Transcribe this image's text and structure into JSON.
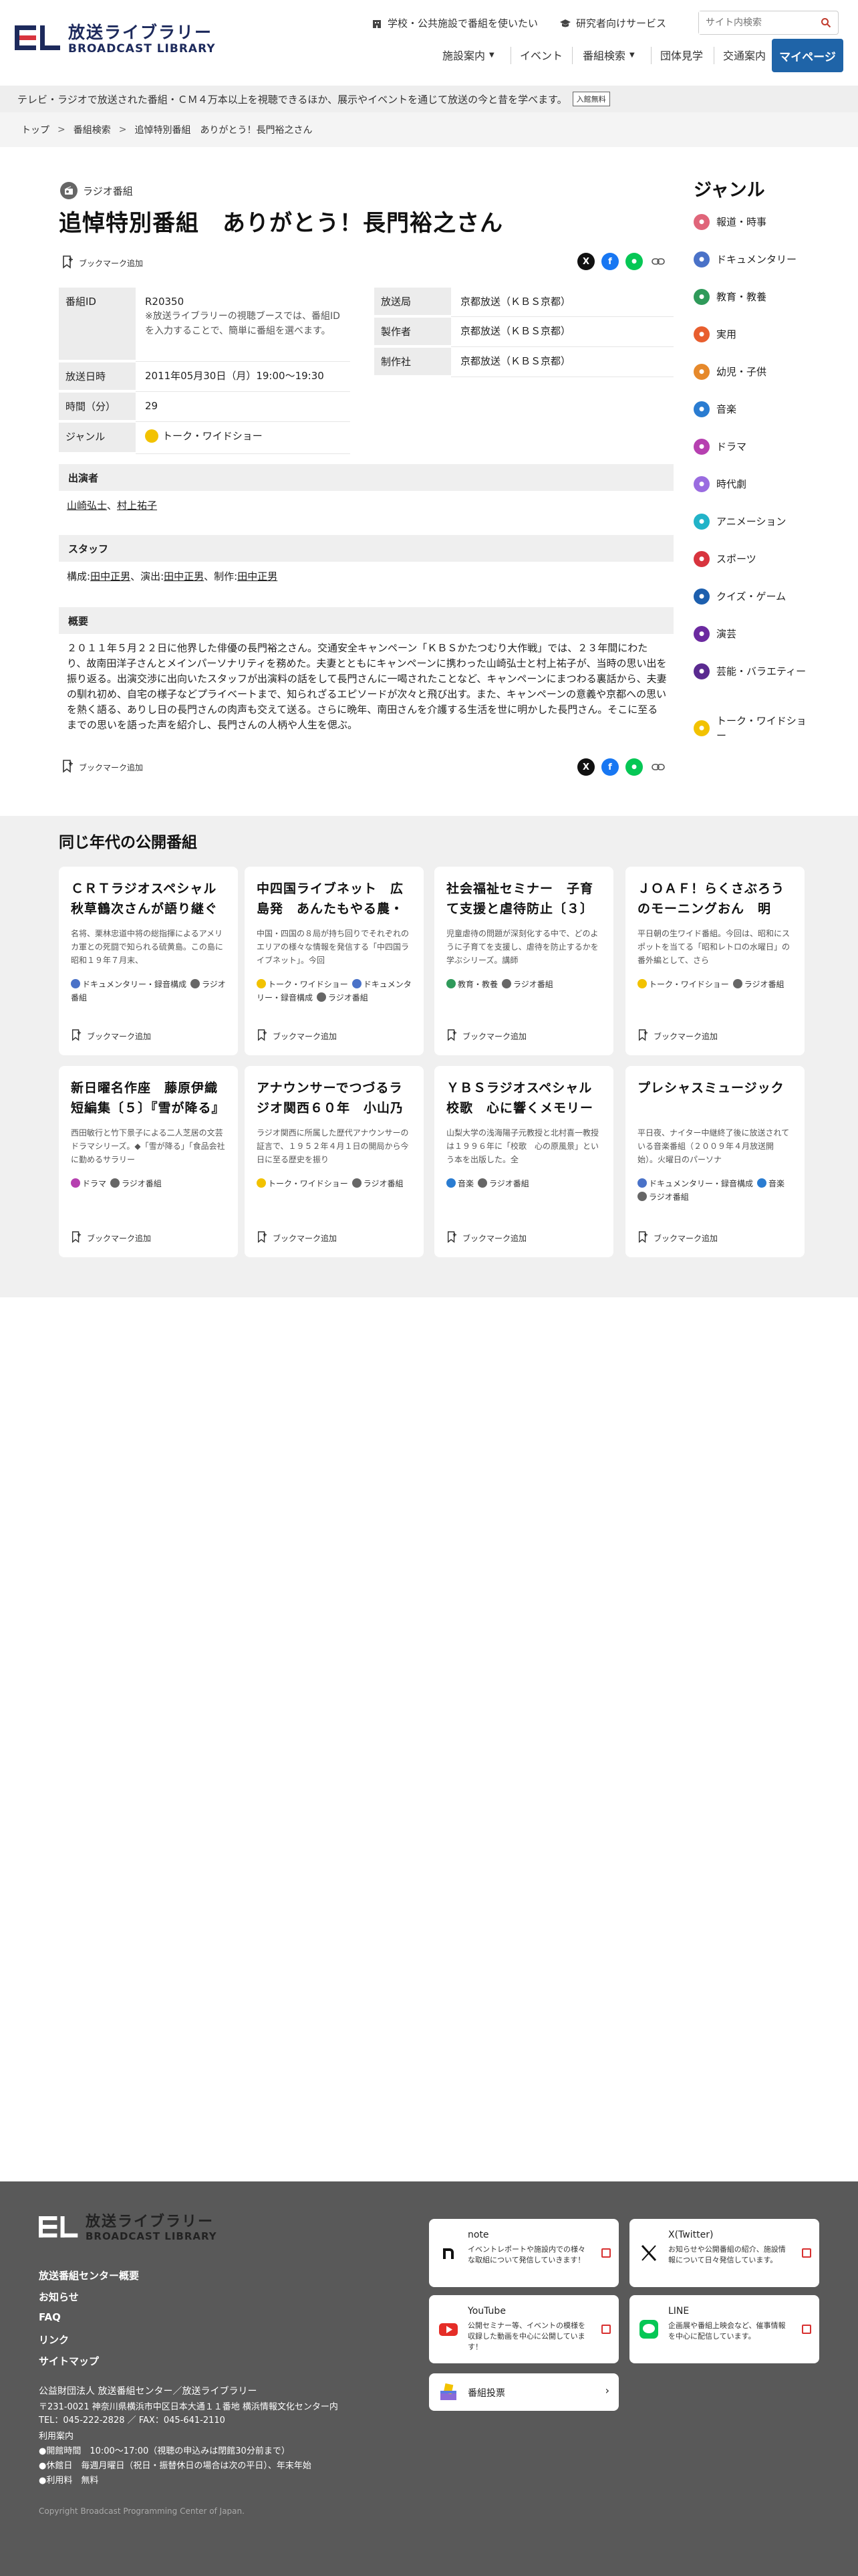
{
  "header": {
    "logo_jp": "放送ライブラリー",
    "logo_en": "BROADCAST LIBRARY",
    "util_links": [
      "学校・公共施設で番組を使いたい",
      "研究者向けサービス"
    ],
    "search_placeholder": "サイト内検索",
    "nav": [
      "施設案内",
      "イベント",
      "番組検索",
      "団体見学",
      "交通案内"
    ],
    "mypage": "マイページ"
  },
  "notice": {
    "text": "テレビ・ラジオで放送された番組・ＣＭ４万本以上を視聴できるほか、展示やイベントを通じて放送の今と昔を学べます。",
    "badge": "入館無料"
  },
  "breadcrumb": [
    "トップ",
    "番組検索",
    "追悼特別番組　ありがとう！長門裕之さん"
  ],
  "program": {
    "category": "ラジオ番組",
    "title": "追悼特別番組　ありがとう！長門裕之さん",
    "bookmark": "ブックマーク追加",
    "fields_left": [
      {
        "label": "番組ID",
        "value": "R20350",
        "note": "※放送ライブラリーの視聴ブースでは、番組IDを入力することで、簡単に番組を選べます。"
      },
      {
        "label": "放送日時",
        "value": "2011年05月30日（月）19:00〜19:30"
      },
      {
        "label": "時間（分）",
        "value": "29"
      },
      {
        "label": "ジャンル",
        "value": "トーク・ワイドショー"
      }
    ],
    "fields_right": [
      {
        "label": "放送局",
        "value": "京都放送（ＫＢＳ京都）"
      },
      {
        "label": "製作者",
        "value": "京都放送（ＫＢＳ京都）"
      },
      {
        "label": "制作社",
        "value": "京都放送（ＫＢＳ京都）"
      }
    ],
    "cast_header": "出演者",
    "cast": [
      "山崎弘士",
      "村上祐子"
    ],
    "staff_header": "スタッフ",
    "staff_prefix_1": "構成:",
    "staff_name_1": "田中正男",
    "staff_prefix_2": "、演出:",
    "staff_name_2": "田中正男",
    "staff_prefix_3": "、制作:",
    "staff_name_3": "田中正男",
    "summary_header": "概要",
    "summary": "２０１１年５月２２日に他界した俳優の長門裕之さん。交通安全キャンペーン「ＫＢＳかたつむり大作戦」では、２３年間にわたり、故南田洋子さんとメインパーソナリティを務めた。夫妻とともにキャンペーンに携わった山崎弘士と村上祐子が、当時の思い出を振り返る。出演交渉に出向いたスタッフが出演料の話をして長門さんに一喝されたことなど、キャンペーンにまつわる裏話から、夫妻の馴れ初め、自宅の様子などプライベートまで、知られざるエピソードが次々と飛び出す。また、キャンペーンの意義や京都への思いを熱く語る、ありし日の長門さんの肉声も交えて送る。さらに晩年、南田さんを介護する生活を世に明かした長門さん。そこに至るまでの思いを語った声を紹介し、長門さんの人柄や人生を偲ぶ。"
  },
  "sidebar": {
    "title": "ジャンル",
    "genres": [
      {
        "label": "報道・時事",
        "color": "#e0657a"
      },
      {
        "label": "ドキュメンタリー",
        "color": "#4a72c8"
      },
      {
        "label": "教育・教養",
        "color": "#2f9a5a"
      },
      {
        "label": "実用",
        "color": "#e85e2e"
      },
      {
        "label": "幼児・子供",
        "color": "#e6892b"
      },
      {
        "label": "音楽",
        "color": "#2a7cd1"
      },
      {
        "label": "ドラマ",
        "color": "#b640b0"
      },
      {
        "label": "時代劇",
        "color": "#9a6ce0"
      },
      {
        "label": "アニメーション",
        "color": "#22b3c8"
      },
      {
        "label": "スポーツ",
        "color": "#d8343e"
      },
      {
        "label": "クイズ・ゲーム",
        "color": "#1d5fae"
      },
      {
        "label": "演芸",
        "color": "#6b2aa0"
      },
      {
        "label": "芸能・バラエティー",
        "color": "#5a2a90"
      },
      {
        "label": "トーク・ワイドショー",
        "color": "#f2c200"
      }
    ]
  },
  "related": {
    "title": "同じ年代の公開番組",
    "bookmark": "ブックマーク追加",
    "cards": [
      {
        "title": "ＣＲＴラジオスペシャル　秋草鶴次さんが語り継ぐ硫黄島",
        "desc": "名将、栗林忠道中将の総指揮によるアメリカ軍との死闘で知られる硫黄島。この島に昭和１９年７月末、",
        "genres": [
          {
            "label": "ドキュメンタリー・録音構成",
            "color": "#4a72c8"
          },
          {
            "label": "ラジオ番組",
            "color": "#666666"
          }
        ]
      },
      {
        "title": "中四国ライブネット　広島発　あんたもやる農・広島",
        "desc": "中国・四国の８局が持ち回りでそれぞれのエリアの様々な情報を発信する「中四国ライブネット」。今回",
        "genres": [
          {
            "label": "トーク・ワイドショー",
            "color": "#f2c200"
          },
          {
            "label": "ドキュメンタリー・録音構成",
            "color": "#4a72c8"
          },
          {
            "label": "ラジオ番組",
            "color": "#666666"
          }
        ]
      },
      {
        "title": "社会福祉セミナー　子育て支援と虐待防止〔３〕",
        "desc": "児童虐待の問題が深刻化する中で、どのように子育てを支援し、虐待を防止するかを学ぶシリーズ。講師",
        "genres": [
          {
            "label": "教育・教養",
            "color": "#2f9a5a"
          },
          {
            "label": "ラジオ番組",
            "color": "#666666"
          }
        ]
      },
      {
        "title": "ＪＯＡＦ！らくさぶろうのモーニングおん　明",
        "desc": "平日朝の生ワイド番組。今回は、昭和にスポットを当てる「昭和レトロの水曜日」の番外編として、さら",
        "genres": [
          {
            "label": "トーク・ワイドショー",
            "color": "#f2c200"
          },
          {
            "label": "ラジオ番組",
            "color": "#666666"
          }
        ]
      },
      {
        "title": "新日曜名作座　藤原伊織短編集〔５〕『雪が降る』",
        "desc": "西田敏行と竹下景子による二人芝居の文芸ドラマシリーズ。◆「雪が降る」「食品会社に勤めるサラリー",
        "genres": [
          {
            "label": "ドラマ",
            "color": "#b640b0"
          },
          {
            "label": "ラジオ番組",
            "color": "#666666"
          }
        ]
      },
      {
        "title": "アナウンサーでつづるラジオ関西６０年　小山乃",
        "desc": "ラジオ関西に所属した歴代アナウンサーの証言で、１９５２年４月１日の開局から今日に至る歴史を振り",
        "genres": [
          {
            "label": "トーク・ワイドショー",
            "color": "#f2c200"
          },
          {
            "label": "ラジオ番組",
            "color": "#666666"
          }
        ]
      },
      {
        "title": "ＹＢＳラジオスペシャル　校歌　心に響くメモリー",
        "desc": "山梨大学の浅海陽子元教授と北村喜一教授は１９９６年に「校歌　心の原風景」という本を出版した。全",
        "genres": [
          {
            "label": "音楽",
            "color": "#2a7cd1"
          },
          {
            "label": "ラジオ番組",
            "color": "#666666"
          }
        ]
      },
      {
        "title": "プレシャスミュージック",
        "desc": "平日夜、ナイター中継終了後に放送されている音楽番組（２００９年４月放送開始）。火曜日のパーソナ",
        "genres": [
          {
            "label": "ドキュメンタリー・録音構成",
            "color": "#4a72c8"
          },
          {
            "label": "音楽",
            "color": "#2a7cd1"
          },
          {
            "label": "ラジオ番組",
            "color": "#666666"
          }
        ]
      }
    ]
  },
  "footer": {
    "logo_jp": "放送ライブラリー",
    "logo_en": "BROADCAST LIBRARY",
    "links": [
      "放送番組センター概要",
      "お知らせ",
      "FAQ",
      "リンク",
      "サイトマップ"
    ],
    "org": "公益財団法人 放送番組センター／放送ライブラリー",
    "address": "〒231-0021 神奈川県横浜市中区日本大通１１番地 横浜情報文化センター内",
    "tel": "TEL：045-222-2828 ／ FAX：045-641-2110",
    "guide_title": "利用案内",
    "hours": "●開館時間　10:00〜17:00（視聴の申込みは閉館30分前まで）",
    "closed": "●休館日　毎週月曜日（祝日・振替休日の場合は次の平日）、年末年始",
    "fee": "●利用料　無料",
    "sns": [
      {
        "name": "note",
        "desc": "イベントレポートや施設内での様々な取組について発信していきます！"
      },
      {
        "name": "X(Twitter)",
        "desc": "お知らせや公開番組の紹介、施設情報について日々発信しています。"
      },
      {
        "name": "YouTube",
        "desc": "公開セミナー等、イベントの模様を収録した動画を中心に公開しています！"
      },
      {
        "name": "LINE",
        "desc": "企画展や番組上映会など、催事情報を中心に配信しています。"
      }
    ],
    "vote": "番組投票",
    "copyright": "Copyright Broadcast Programming Center of Japan."
  }
}
